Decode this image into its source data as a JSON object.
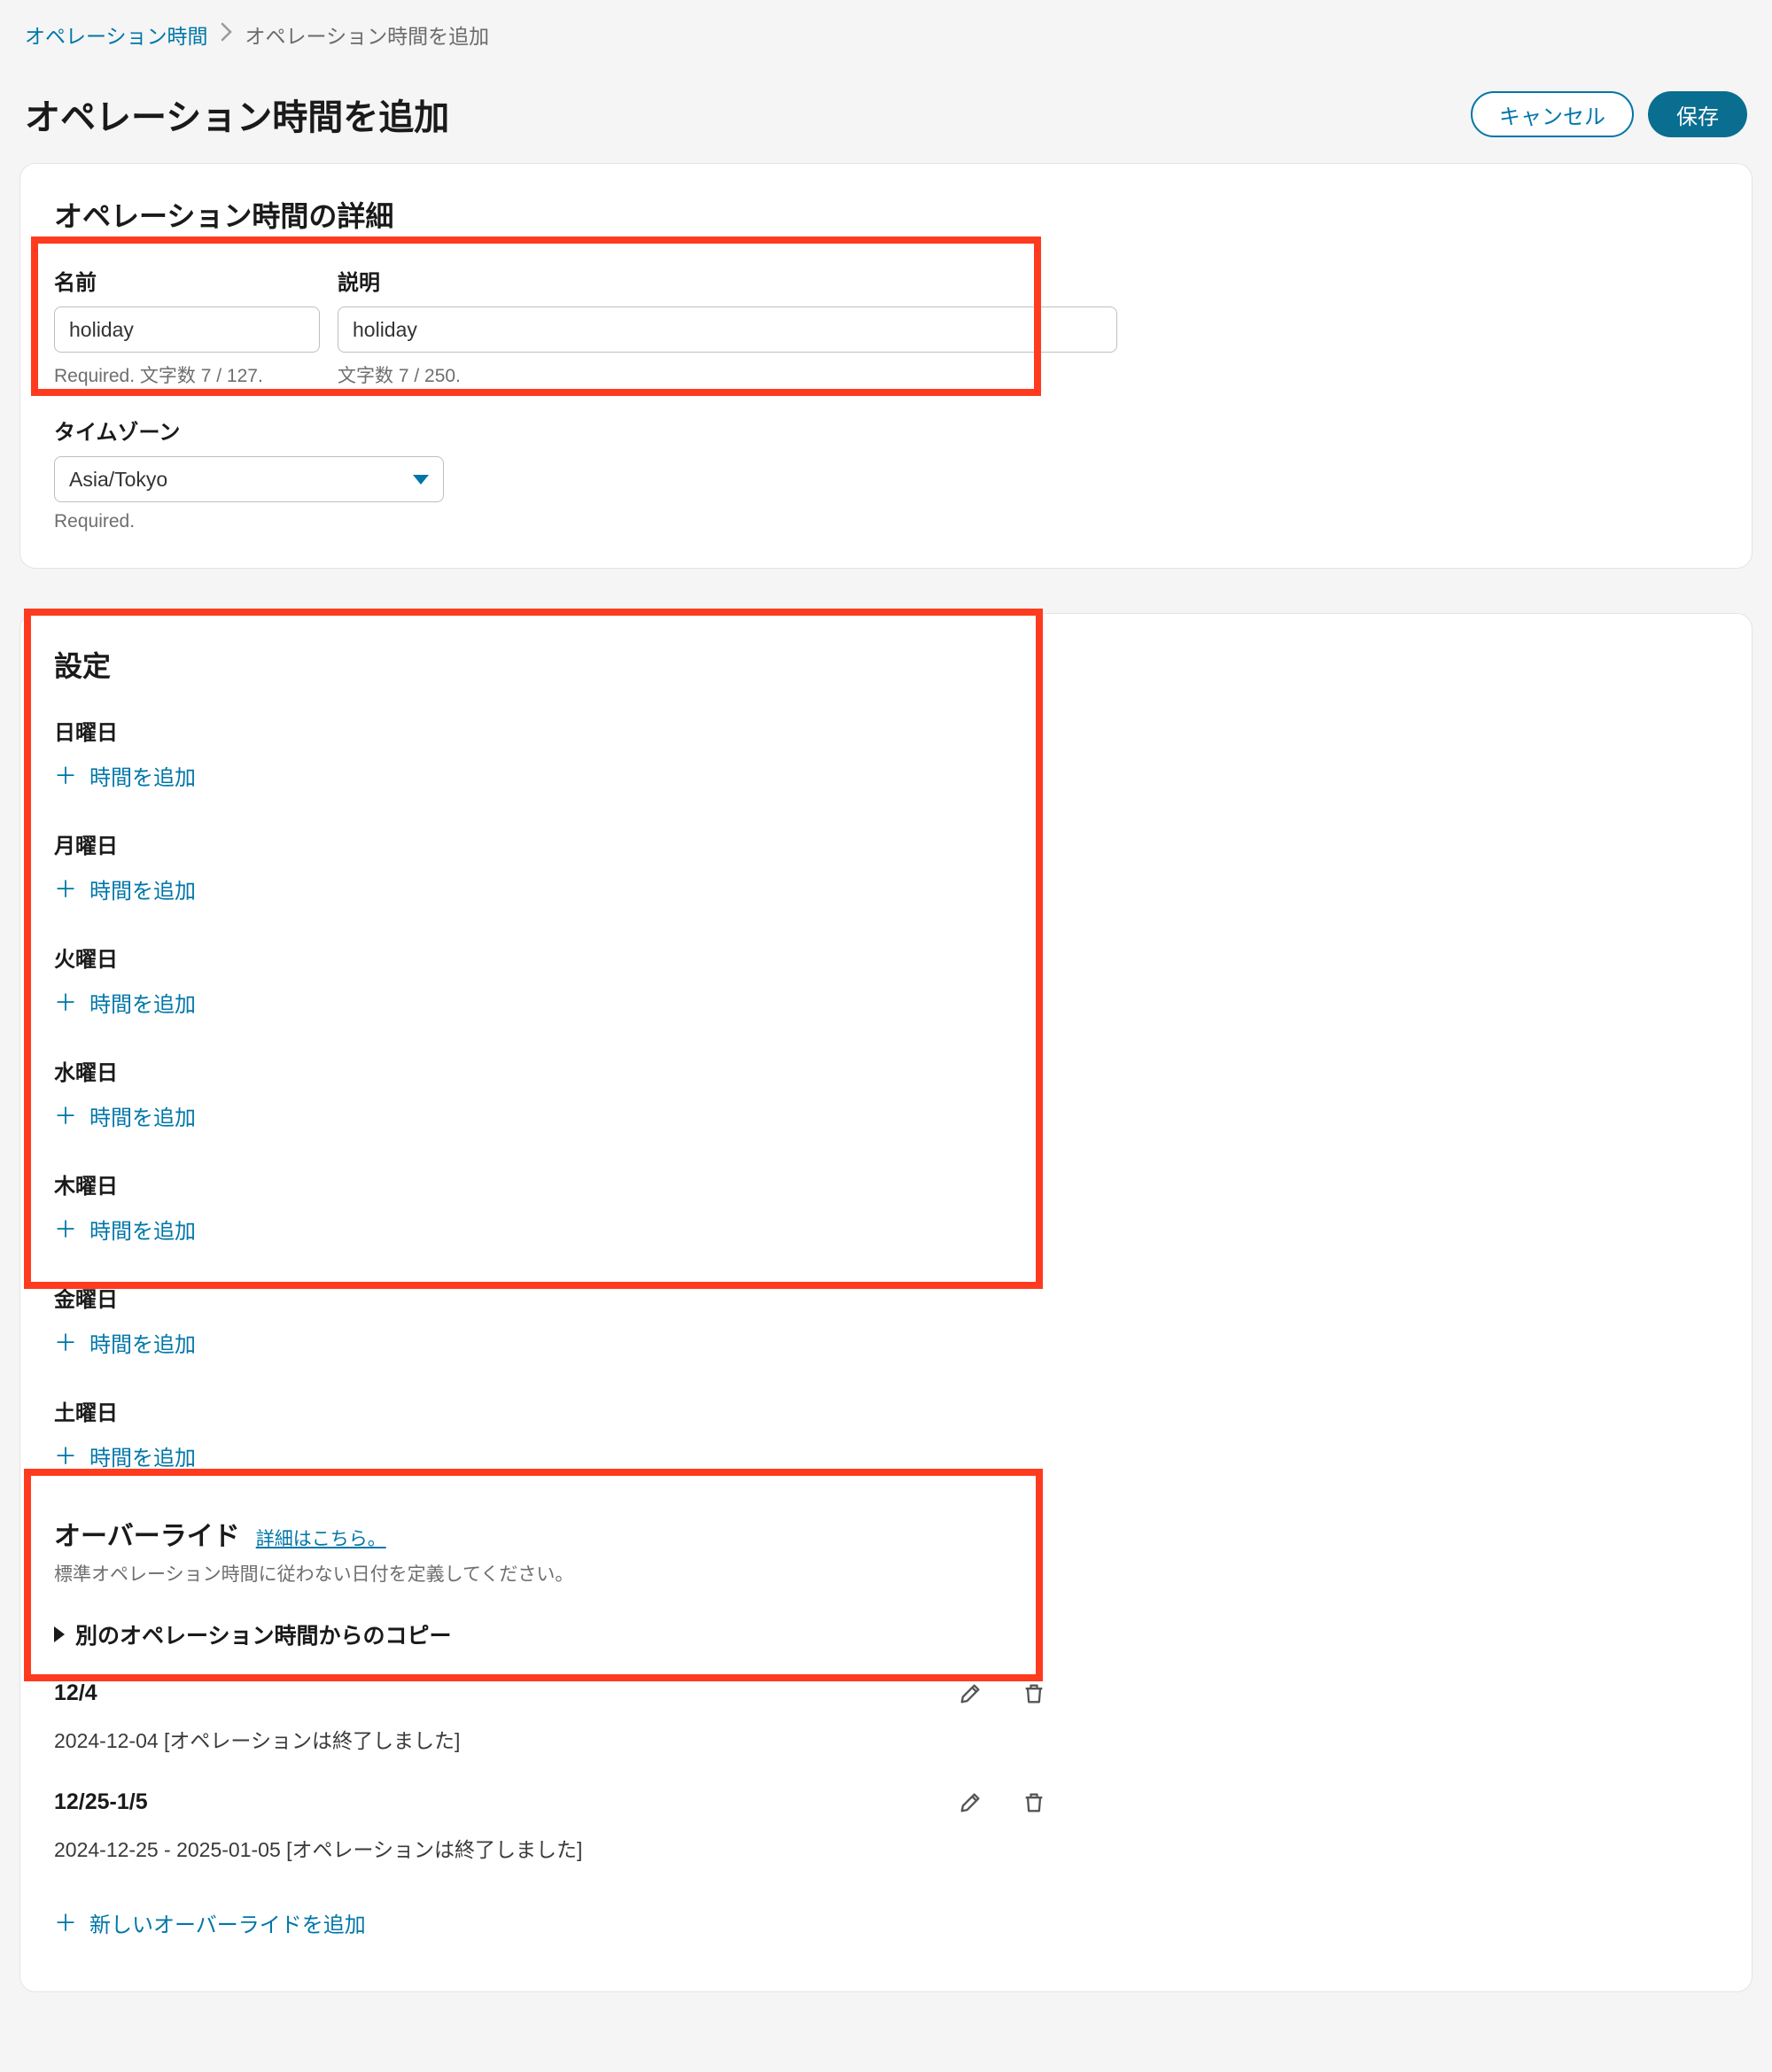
{
  "breadcrumb": {
    "parent": "オペレーション時間",
    "current": "オペレーション時間を追加"
  },
  "header": {
    "title": "オペレーション時間を追加",
    "cancel": "キャンセル",
    "save": "保存"
  },
  "details": {
    "panel_title": "オペレーション時間の詳細",
    "name_label": "名前",
    "name_value": "holiday",
    "name_hint": "Required. 文字数 7 / 127.",
    "desc_label": "説明",
    "desc_value": "holiday",
    "desc_hint": "文字数 7 / 250.",
    "tz_label": "タイムゾーン",
    "tz_value": "Asia/Tokyo",
    "tz_hint": "Required."
  },
  "settings": {
    "panel_title": "設定",
    "add_time_label": "時間を追加",
    "days": [
      "日曜日",
      "月曜日",
      "火曜日",
      "水曜日",
      "木曜日",
      "金曜日",
      "土曜日"
    ]
  },
  "overrides": {
    "title": "オーバーライド",
    "more_link": "詳細はこちら。",
    "description": "標準オペレーション時間に従わない日付を定義してください。",
    "copy_label": "別のオペレーション時間からのコピー",
    "add_new": "新しいオーバーライドを追加",
    "items": [
      {
        "title": "12/4",
        "detail": "2024-12-04 [オペレーションは終了しました]"
      },
      {
        "title": "12/25-1/5",
        "detail": "2024-12-25 - 2025-01-05 [オペレーションは終了しました]"
      }
    ]
  }
}
